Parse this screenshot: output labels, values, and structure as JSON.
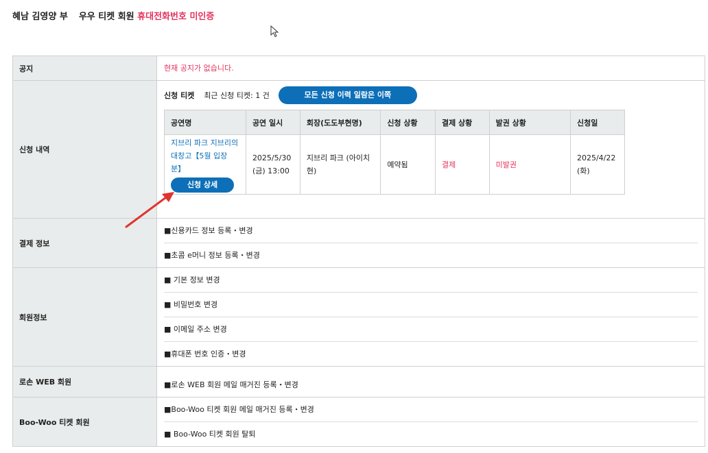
{
  "header": {
    "user_name": "혜남 김영양 부",
    "member_type": "우우 티켓 회원",
    "phone_status": "휴대전화번호 미인증"
  },
  "notice": {
    "label": "공지",
    "text": "현재 공지가 없습니다."
  },
  "applications": {
    "label": "신청 내역",
    "ticket_title": "신청 티켓",
    "recent_count": "최근 신청 티켓: 1 건",
    "all_history_button": "모든 신청 이력 일람은 이쪽",
    "columns": [
      "공연명",
      "공연 일시",
      "회장(도도부현명)",
      "신청 상황",
      "결제 상황",
      "발권 상황",
      "신청일"
    ],
    "row": {
      "name": "지브리 파크 지브리의 대창고【5월 입장분】",
      "detail_button": "신청 상세",
      "datetime": "2025/5/30 (금) 13:00",
      "venue": "지브리 파크 (아이치현)",
      "application_status": "예약됨",
      "payment_status": "결제",
      "issuance_status": "미발권",
      "applied_date": "2025/4/22 (화)"
    }
  },
  "payment_info": {
    "label": "결제 정보",
    "items": [
      "■신용카드 정보 등록・변경",
      "■초콤 e머니 정보 등록・변경"
    ]
  },
  "member_info": {
    "label": "회원정보",
    "items": [
      "■ 기본 정보 변경",
      "■ 비밀번호 변경",
      "■ 이메일 주소 변경",
      "■휴대폰 번호 인증・변경"
    ]
  },
  "lawson_web": {
    "label": "로손 WEB 회원",
    "items": [
      "■로손 WEB 회원 메일 매거진 등록・변경"
    ]
  },
  "boowoo": {
    "label": "Boo-Woo 티켓 회원",
    "items": [
      "■Boo-Woo 티켓 회원 메일 매거진 등록・변경",
      "■ Boo-Woo 티켓 회원 탈퇴"
    ]
  },
  "colors": {
    "accent": "#0d6fb8",
    "alert": "#e5335d",
    "label_bg": "#e9ecec",
    "annotation_arrow": "#e0342f"
  }
}
